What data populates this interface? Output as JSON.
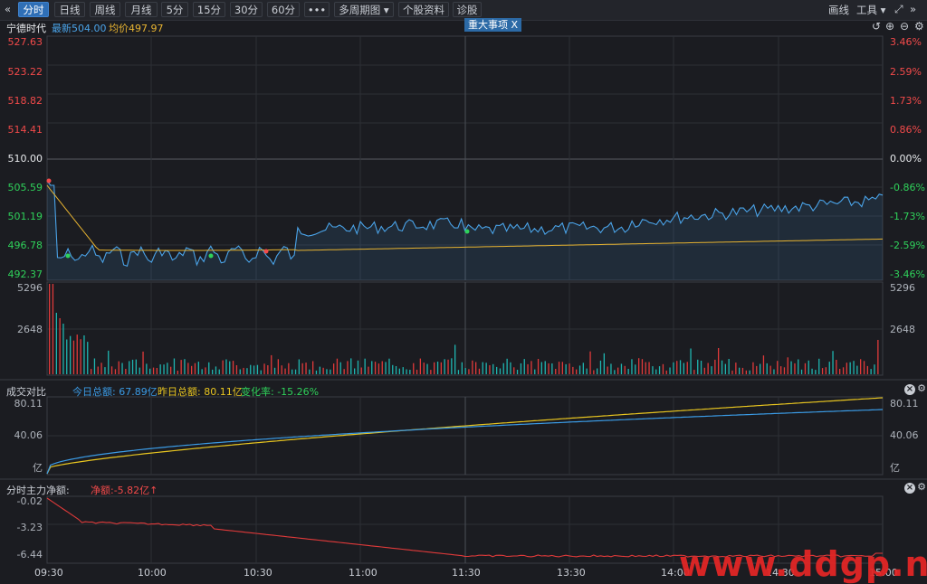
{
  "toolbar": {
    "back_icon": "«",
    "tabs": [
      "分时",
      "日线",
      "周线",
      "月线",
      "5分",
      "15分",
      "30分",
      "60分",
      "•••",
      "多周期图 ▾",
      "个股资料",
      "诊股"
    ],
    "active_tab": "分时",
    "right": {
      "draw": "画线",
      "tools": "工具 ▾",
      "fullscreen_icon": "expand-icon",
      "more_icon": "»"
    }
  },
  "info": {
    "stock_name": "宁德时代",
    "latest_label": "最新504.00",
    "avg_label": "均价497.97",
    "event_tag": "重大事项  X"
  },
  "price_axis": {
    "left": [
      "527.63",
      "523.22",
      "518.82",
      "514.41",
      "510.00",
      "505.59",
      "501.19",
      "496.78",
      "492.37"
    ],
    "right": [
      "3.46%",
      "2.59%",
      "1.73%",
      "0.86%",
      "0.00%",
      "-0.86%",
      "-1.73%",
      "-2.59%",
      "-3.46%"
    ]
  },
  "volume_axis": {
    "left": [
      "5296",
      "2648"
    ],
    "right": [
      "5296",
      "2648"
    ]
  },
  "turnover_panel": {
    "title": "成交对比",
    "today": "今日总额: 67.89亿",
    "yesterday": "昨日总额: 80.11亿",
    "change": "变化率: -15.26%",
    "axis": [
      "80.11",
      "40.06",
      "亿"
    ]
  },
  "mainflow_panel": {
    "title": "分时主力净额:",
    "net": "净额:-5.82亿↑",
    "axis": [
      "-0.02",
      "-3.23",
      "-6.44"
    ]
  },
  "time_axis": [
    "09:30",
    "10:00",
    "10:30",
    "11:00",
    "11:30",
    "13:30",
    "14:00",
    "14:30",
    "15:00"
  ],
  "watermark": "www.ddgp.net",
  "colors": {
    "up": "#f24a4a",
    "down": "#2fd15a",
    "price": "#4aa3e8",
    "avg": "#e8b431",
    "flow": "#e03a3a"
  }
}
